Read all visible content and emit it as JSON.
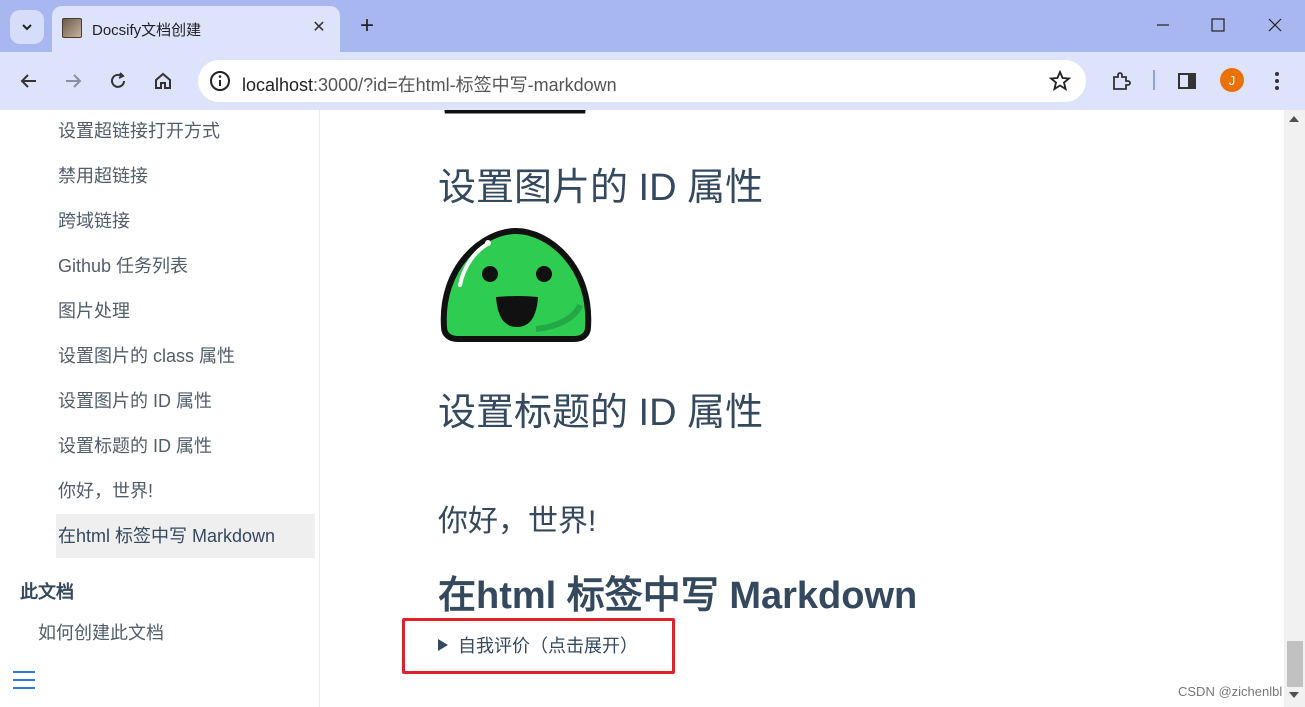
{
  "browser": {
    "tab_title": "Docsify文档创建",
    "url_host": "localhost",
    "url_rest": ":3000/?id=在html-标签中写-markdown",
    "avatar_letter": "J"
  },
  "sidebar": {
    "items": [
      {
        "label": "设置超链接打开方式"
      },
      {
        "label": "禁用超链接"
      },
      {
        "label": "跨域链接"
      },
      {
        "label": "Github 任务列表"
      },
      {
        "label": "图片处理"
      },
      {
        "label": "设置图片的 class 属性"
      },
      {
        "label": "设置图片的 ID 属性"
      },
      {
        "label": "设置标题的 ID 属性"
      },
      {
        "label": "你好，世界!"
      },
      {
        "label": "在html 标签中写 Markdown"
      }
    ],
    "section_title": "此文档",
    "section_items": [
      {
        "label": "如何创建此文档"
      }
    ]
  },
  "content": {
    "heading_image_id": "设置图片的 ID 属性",
    "heading_title_id": "设置标题的 ID 属性",
    "hello_text": "你好，世界!",
    "heading_markdown": "在html 标签中写 Markdown",
    "details_summary": "自我评价（点击展开）"
  },
  "watermark": "CSDN @zichenlbl",
  "colors": {
    "titlebar": "#a9b7f0",
    "toolbar": "#dde3fb",
    "text": "#34495e",
    "highlight": "#e0202a",
    "slime_green": "#2ecc51"
  }
}
